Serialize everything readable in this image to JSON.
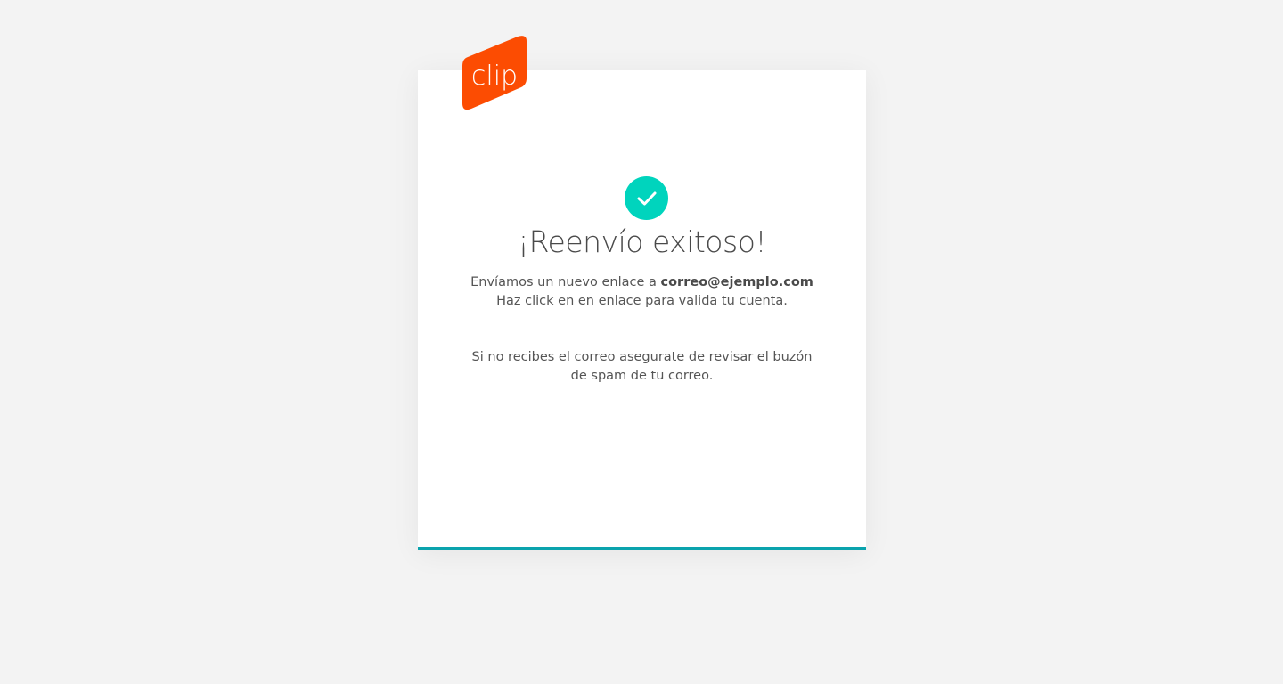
{
  "logo": {
    "text": "clip",
    "color": "#fc4c02"
  },
  "title": "¡Reenvío exitoso!",
  "message": {
    "line1_prefix": "Envíamos un nuevo enlace a ",
    "email": "correo@ejemplo.com",
    "line2": "Haz click en en enlace para valida tu cuenta."
  },
  "spam_note": {
    "line1": "Si no recibes el correo asegurate de revisar el buzón",
    "line2": "de spam de tu correo."
  },
  "colors": {
    "success": "#00d4bd",
    "accent_bar": "#0aa3ad"
  }
}
